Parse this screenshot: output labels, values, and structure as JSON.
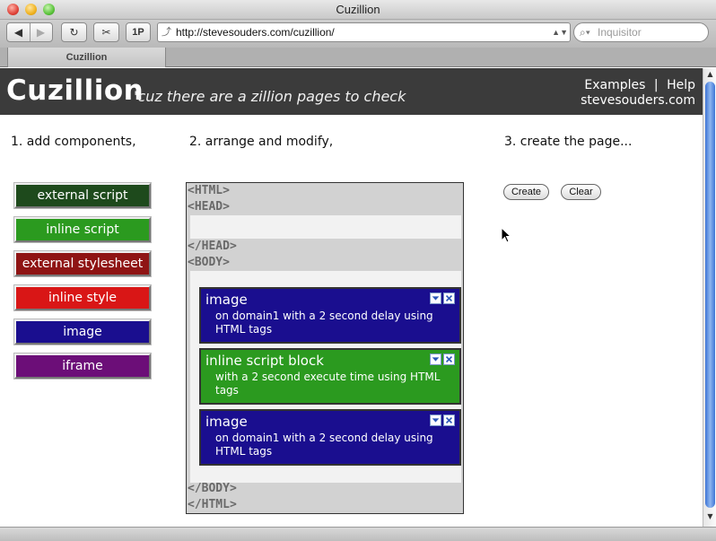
{
  "window": {
    "title": "Cuzillion"
  },
  "toolbar": {
    "back": "◀",
    "forward": "▶",
    "reload": "↻",
    "snippet": "✂",
    "one_p": "1P",
    "url": "http://stevesouders.com/cuzillion/",
    "search_placeholder": "Inquisitor"
  },
  "tabs": [
    {
      "label": "Cuzillion"
    }
  ],
  "header": {
    "logo": "Cuzillion",
    "tagline": "'cuz there are a zillion pages to check",
    "links": {
      "examples": "Examples",
      "separator": "|",
      "help": "Help",
      "site": "stevesouders.com"
    }
  },
  "steps": {
    "add": "1. add components,",
    "arrange": "2. arrange and modify,",
    "create": "3. create the page..."
  },
  "palette": [
    {
      "label": "external script",
      "color": "#1e4a1c"
    },
    {
      "label": "inline script",
      "color": "#2b9a1f"
    },
    {
      "label": "external stylesheet",
      "color": "#8f1414"
    },
    {
      "label": "inline style",
      "color": "#d91616"
    },
    {
      "label": "image",
      "color": "#1a0e8f"
    },
    {
      "label": "iframe",
      "color": "#6c0e78"
    }
  ],
  "canvas": {
    "tags": {
      "html_open": "<HTML>",
      "head_open": "<HEAD>",
      "head_close": "</HEAD>",
      "body_open": "<BODY>",
      "body_close": "</BODY>",
      "html_close": "</HTML>"
    },
    "components": [
      {
        "title": "image",
        "desc": "on domain1 with a 2 second delay using HTML tags",
        "color": "#1a0e8f"
      },
      {
        "title": "inline script block",
        "desc": "with a 2 second execute time using HTML tags",
        "color": "#2b9a1f"
      },
      {
        "title": "image",
        "desc": "on domain1 with a 2 second delay using HTML tags",
        "color": "#1a0e8f"
      }
    ]
  },
  "actions": {
    "create": "Create",
    "clear": "Clear"
  },
  "icons": {
    "dropdown": "▼",
    "close": "✕"
  }
}
